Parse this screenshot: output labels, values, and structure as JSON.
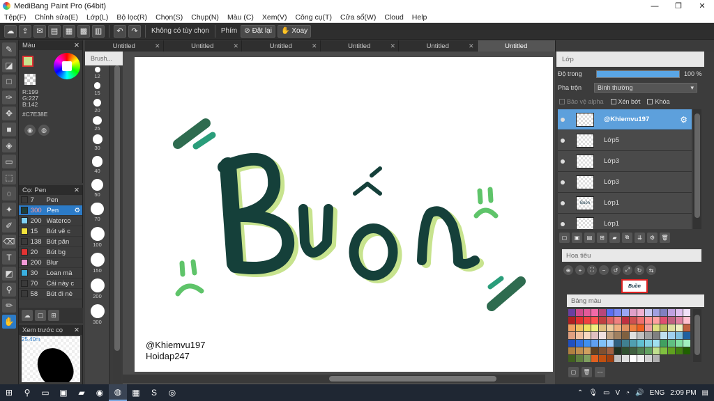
{
  "window": {
    "title": "MediBang Paint Pro (64bit)",
    "min_glyph": "—",
    "max_glyph": "❐",
    "close_glyph": "✕"
  },
  "menu": [
    "Tệp(F)",
    "Chỉnh sửa(E)",
    "Lớp(L)",
    "Bộ lọc(R)",
    "Chọn(S)",
    "Chụp(N)",
    "Màu (C)",
    "Xem(V)",
    "Công cụ(T)",
    "Cửa sổ(W)",
    "Cloud",
    "Help"
  ],
  "toolbar": {
    "no_options": "Không có tùy chọn",
    "key_label": "Phím",
    "reset_label": "Đặt lại",
    "rotate_label": "Xoay"
  },
  "tabs": [
    "Untitled",
    "Untitled",
    "Untitled",
    "Untitled",
    "Untitled",
    "Untitled"
  ],
  "tab_close_glyph": "✕",
  "color_panel": {
    "title": "Màu",
    "r": "R:199",
    "g": "G:227",
    "b": "B:142",
    "hex": "#C7E38E"
  },
  "brush_panel": {
    "title": "Cọ: Pen",
    "items": [
      {
        "size": "7",
        "name": "Pen",
        "color": "#3a3a3a"
      },
      {
        "size": "300",
        "name": "Pen",
        "color": "#1d3f3a"
      },
      {
        "size": "200",
        "name": "Waterco",
        "color": "#7fd0f2"
      },
      {
        "size": "15",
        "name": "Bút vẽ c",
        "color": "#f2e23a"
      },
      {
        "size": "138",
        "name": "Bút păn",
        "color": "#3a3a3a"
      },
      {
        "size": "20",
        "name": "Bút bg",
        "color": "#e33333"
      },
      {
        "size": "200",
        "name": "Blur",
        "color": "#f29ad8"
      },
      {
        "size": "30",
        "name": "Loan mà",
        "color": "#3ab0e0"
      },
      {
        "size": "70",
        "name": "Cái này c",
        "color": "#3a3a3a"
      },
      {
        "size": "58",
        "name": "Bút đi nè",
        "color": "#3a3a3a"
      }
    ]
  },
  "preview_panel": {
    "title": "Xem trước cọ",
    "size": "25.40m"
  },
  "brush_size": {
    "title": "Brush...",
    "sizes": [
      "12",
      "15",
      "20",
      "25",
      "30",
      "40",
      "50",
      "70",
      "100",
      "150",
      "200",
      "300"
    ]
  },
  "canvas": {
    "text_line1": "@Khiemvu197",
    "text_line2": "Hoidap247",
    "art_word": "Buồn"
  },
  "layer_panel": {
    "title": "Lớp",
    "opacity_label": "Độ trong",
    "opacity_value": "100 %",
    "opacity_fraction": 1.0,
    "blend_label": "Pha trộn",
    "blend_value": "Bình thường",
    "protect_alpha": "Bảo vệ alpha",
    "clipping": "Xén bớt",
    "lock": "Khóa",
    "layers": [
      {
        "name": "@Khiemvu197",
        "selected": true,
        "thumb": ""
      },
      {
        "name": "Lớp5",
        "selected": false,
        "thumb": ""
      },
      {
        "name": "Lớp3",
        "selected": false,
        "thumb": ""
      },
      {
        "name": "Lớp3",
        "selected": false,
        "thumb": ""
      },
      {
        "name": "Lớp1",
        "selected": false,
        "thumb": "Buồn"
      },
      {
        "name": "Lớp1",
        "selected": false,
        "thumb": ""
      }
    ]
  },
  "navigator": {
    "title": "Hoa tiêu",
    "thumb_word": "Buồn"
  },
  "palette": {
    "title": "Bảng màu",
    "footer": "---",
    "colors": [
      "#6b3fa0",
      "#d04b8c",
      "#e35a9a",
      "#f26aa8",
      "#b7467a",
      "#5a6ef0",
      "#7a88f2",
      "#9aa6f4",
      "#e0a0c8",
      "#f0b0d0",
      "#c8c8f0",
      "#a0a0e0",
      "#8080c0",
      "#c0a0e0",
      "#e0c0f0",
      "#f0e0f8",
      "#b02020",
      "#e03030",
      "#f04040",
      "#ff5050",
      "#c04040",
      "#e06060",
      "#f08080",
      "#c03040",
      "#d05050",
      "#f07070",
      "#ff9090",
      "#ffa0a0",
      "#e05070",
      "#c06080",
      "#e080a0",
      "#ffc0d0",
      "#f0a060",
      "#f0c060",
      "#f0e060",
      "#f0f080",
      "#e0c080",
      "#f0d0a0",
      "#f0b080",
      "#e09060",
      "#f08040",
      "#f06020",
      "#f0a0a0",
      "#e0e080",
      "#c0c060",
      "#e0e0a0",
      "#f0f0c0",
      "#c06040",
      "#e0a080",
      "#f0c0a0",
      "#f8d8c0",
      "#e0c0c0",
      "#f0e0e0",
      "#c0a080",
      "#a08060",
      "#806040",
      "#e0e0e0",
      "#c0c0c0",
      "#a0a0a0",
      "#808080",
      "#c0e0f0",
      "#a0d0f0",
      "#80c0e0",
      "#2060a0",
      "#2050c0",
      "#3070e0",
      "#4090f0",
      "#60a0f0",
      "#80c0f8",
      "#a0d0ff",
      "#306080",
      "#408090",
      "#50a0b0",
      "#60c0d0",
      "#80d0e0",
      "#a0e0f0",
      "#40a060",
      "#60c080",
      "#80e0a0",
      "#a0f0c0",
      "#b08040",
      "#c09050",
      "#d0a060",
      "#604020",
      "#805030",
      "#a06040",
      "#203020",
      "#305030",
      "#406040",
      "#508050",
      "#60a060",
      "#c0e08e",
      "#80c040",
      "#60a020",
      "#408010",
      "#206000",
      "#406020",
      "#608040",
      "#80a060",
      "#e06020",
      "#c05010",
      "#a04010",
      "#c0c0c0",
      "#e0e0e0",
      "#ffffff",
      "#f0f0f0",
      "#d0d0d0",
      "#b0b0b0"
    ]
  },
  "taskbar": {
    "lang": "ENG",
    "time": "2:09 PM"
  }
}
